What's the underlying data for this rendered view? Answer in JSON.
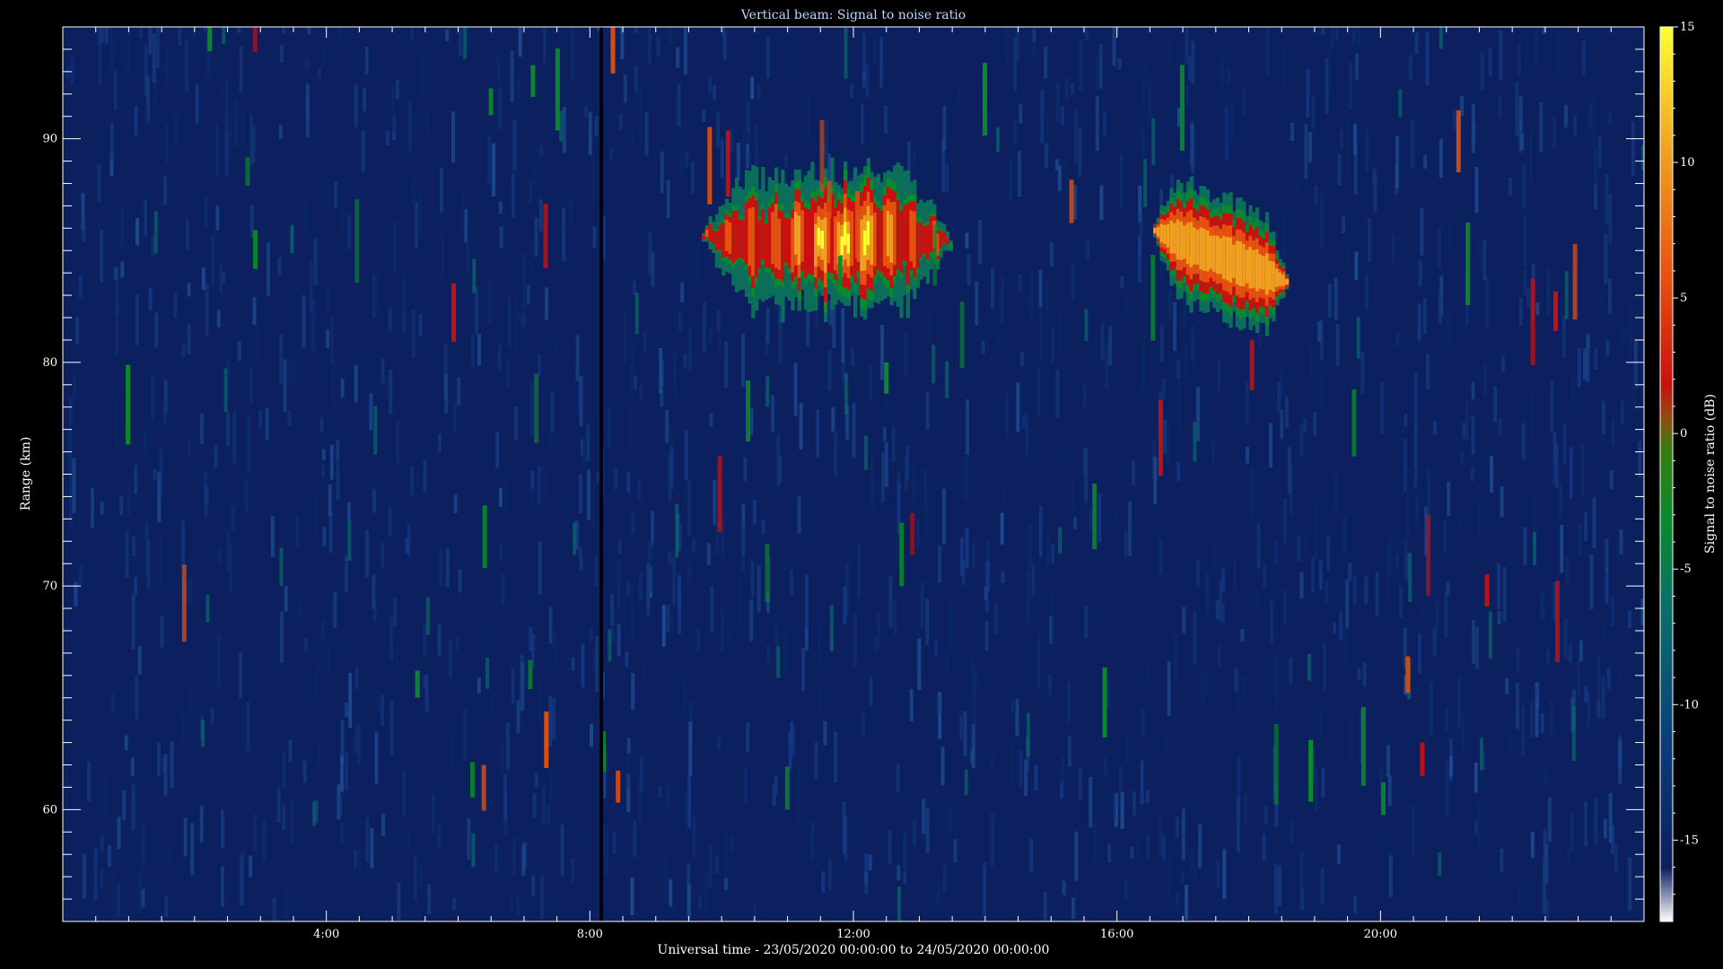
{
  "chart_data": {
    "type": "heatmap",
    "title": "Vertical beam: Signal to noise ratio",
    "xlabel": "Universal time - 23/05/2020 00:00:00 to 24/05/2020 00:00:00",
    "ylabel": "Range (km)",
    "colorbar_label": "Signal to noise ratio (dB)",
    "xlim_hours": [
      0,
      24
    ],
    "x_ticks": [
      {
        "hour": 4,
        "label": "4:00"
      },
      {
        "hour": 8,
        "label": "8:00"
      },
      {
        "hour": 12,
        "label": "12:00"
      },
      {
        "hour": 16,
        "label": "16:00"
      },
      {
        "hour": 20,
        "label": "20:00"
      }
    ],
    "ylim_km": [
      55,
      95
    ],
    "y_ticks": [
      60,
      70,
      80,
      90
    ],
    "clim_db": [
      -18,
      15
    ],
    "c_ticks": [
      15,
      10,
      5,
      0,
      -5,
      -10,
      -15
    ],
    "background_snr_db": -16,
    "data_gap_hours": [
      8.15,
      8.2
    ],
    "echo_regions": [
      {
        "t_start": 9.65,
        "t_end": 13.5,
        "range_low": 82.5,
        "range_high": 88.5,
        "peak_snr_db": 14
      },
      {
        "t_start": 16.5,
        "t_end": 18.6,
        "range_low": 82,
        "range_high": 87.5,
        "peak_snr_db": 6
      }
    ],
    "colormap": [
      "#0c1f5e",
      "#0a3d7a",
      "#0a6e6a",
      "#0a8a3a",
      "#1a8a1a",
      "#6a6010",
      "#c81010",
      "#e86010",
      "#f0a020",
      "#ffff30"
    ]
  },
  "colors": {
    "background": "#000000",
    "plot_background": "#0c1f5e",
    "axes": "#ffffff",
    "title": "#b8d8ff",
    "text": "#ffffff"
  }
}
